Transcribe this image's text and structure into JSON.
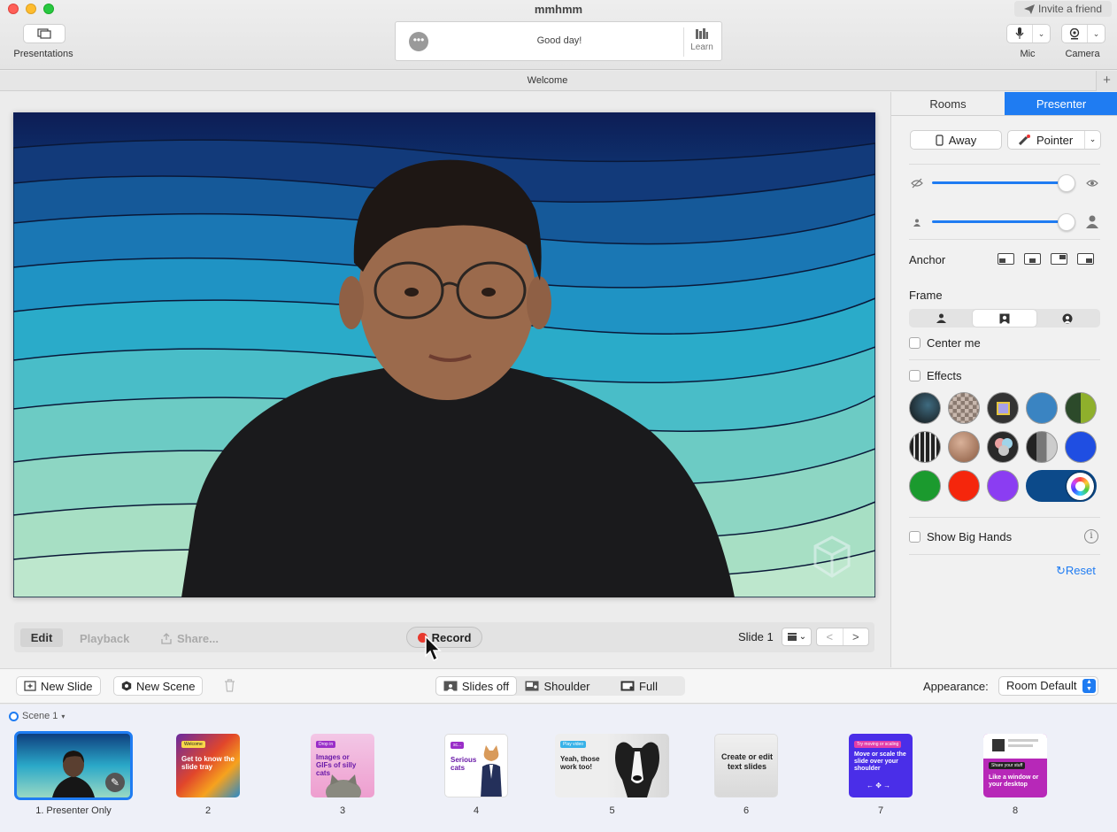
{
  "window": {
    "title": "mmhmm",
    "invite_label": "Invite a friend"
  },
  "header": {
    "presentations_label": "Presentations",
    "message": "Good day!",
    "learn_label": "Learn",
    "mic_label": "Mic",
    "camera_label": "Camera"
  },
  "tabs": {
    "current": "Welcome",
    "add_label": "+"
  },
  "video_bar": {
    "edit_label": "Edit",
    "playback_label": "Playback",
    "share_label": "Share...",
    "record_label": "Record",
    "slide_label": "Slide 1",
    "prev_label": "<",
    "next_label": ">"
  },
  "right_panel": {
    "tabs": [
      "Rooms",
      "Presenter"
    ],
    "active_tab": "Presenter",
    "away_label": "Away",
    "pointer_label": "Pointer",
    "opacity_level": 0.95,
    "size_level": 0.95,
    "anchor_label": "Anchor",
    "frame_label": "Frame",
    "center_me_label": "Center me",
    "effects_label": "Effects",
    "show_big_hands_label": "Show Big Hands",
    "info_label": "i",
    "reset_label": "Reset",
    "accent_color": "#1f7cf2"
  },
  "toolbar": {
    "new_slide_label": "New Slide",
    "new_scene_label": "New Scene",
    "slides_off_label": "Slides off",
    "shoulder_label": "Shoulder",
    "full_label": "Full",
    "appearance_label": "Appearance:",
    "appearance_value": "Room Default"
  },
  "tray": {
    "scene_label": "Scene 1",
    "slides": [
      {
        "number": "1. Presenter Only"
      },
      {
        "number": "2",
        "tag": "Welcome",
        "text": "Get to know the slide tray"
      },
      {
        "number": "3",
        "tag": "Drop in",
        "text": "Images or GIFs of silly cats"
      },
      {
        "number": "4",
        "tag": "sc...",
        "text": "Serious cats"
      },
      {
        "number": "5",
        "tag": "Play video",
        "text": "Yeah, those work too!"
      },
      {
        "number": "6",
        "text": "Create or edit text slides"
      },
      {
        "number": "7",
        "tag": "Try moving or scaling",
        "text": "Move or scale the slide over your shoulder"
      },
      {
        "number": "8",
        "tag": "Share your stuff",
        "text": "Like a window or your desktop"
      }
    ]
  }
}
